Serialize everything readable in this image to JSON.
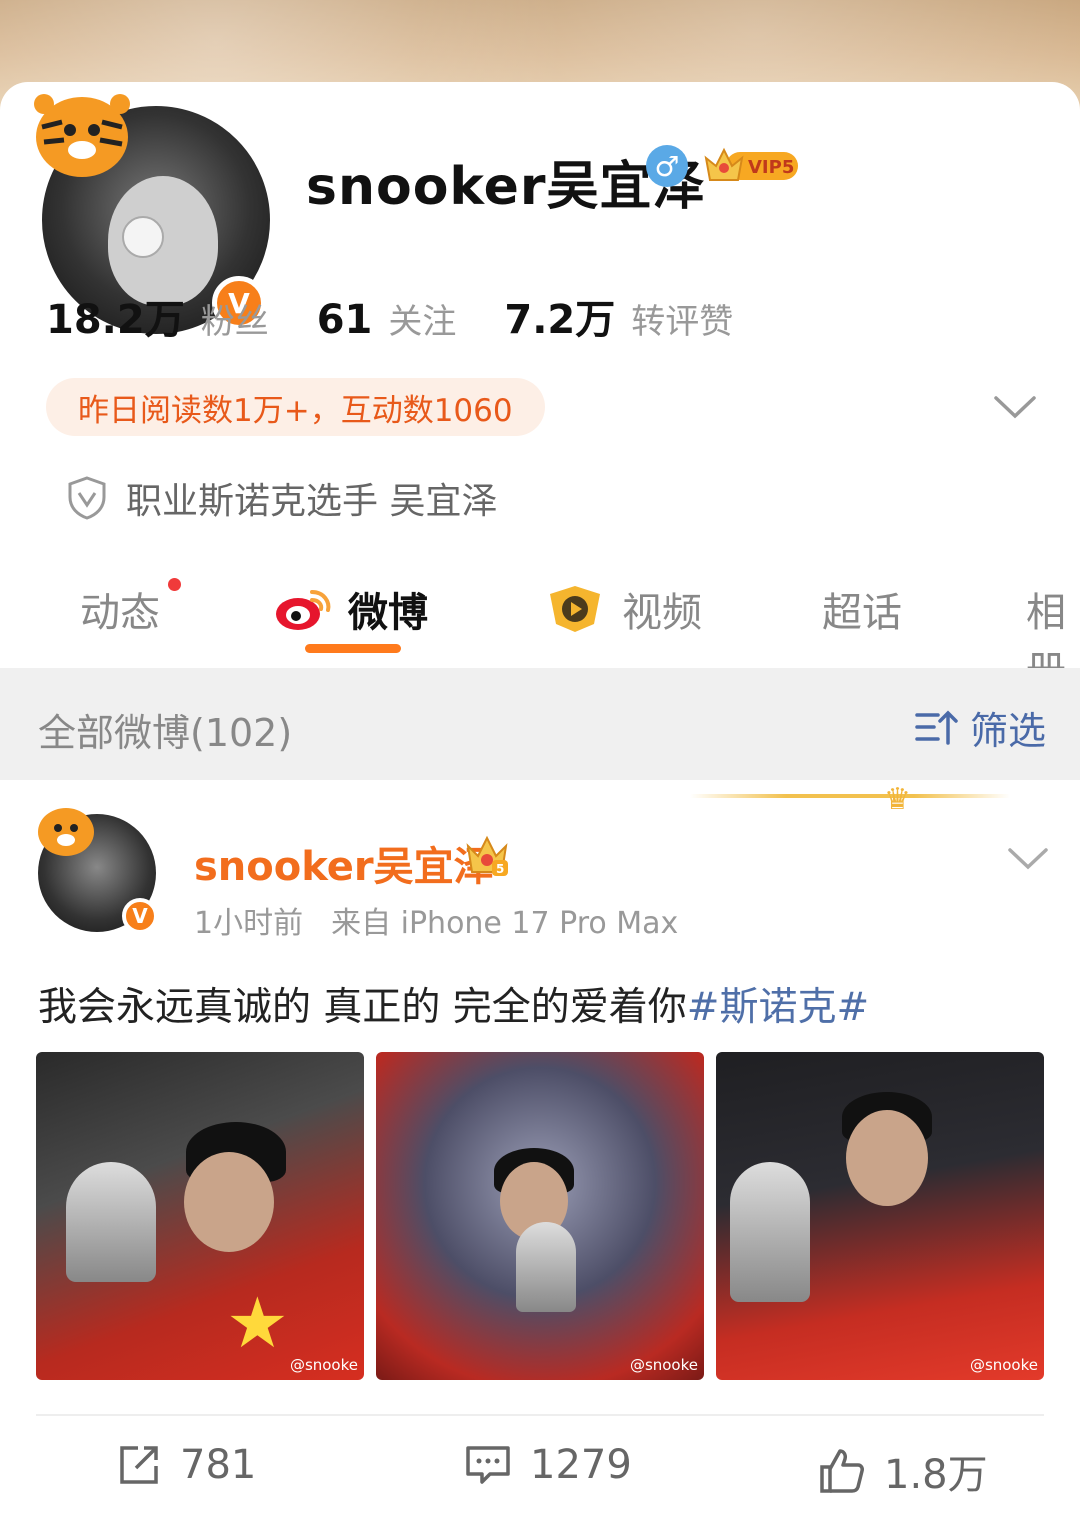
{
  "profile": {
    "username": "snooker吴宜泽",
    "gender_symbol": "♂",
    "vip_label": "VIP5",
    "verified_badge": "V",
    "stats": [
      {
        "value": "18.2万",
        "label": "粉丝"
      },
      {
        "value": "61",
        "label": "关注"
      },
      {
        "value": "7.2万",
        "label": "转评赞"
      }
    ],
    "read_summary": "昨日阅读数1万+，互动数1060",
    "verification": "职业斯诺克选手 吴宜泽"
  },
  "tabs": [
    {
      "label": "动态",
      "has_dot": true
    },
    {
      "label": "微博",
      "active": true
    },
    {
      "label": "视频"
    },
    {
      "label": "超话"
    },
    {
      "label": "相册"
    }
  ],
  "filter": {
    "all_posts": "全部微博(102)",
    "filter_label": "筛选"
  },
  "post": {
    "author": "snooker吴宜泽",
    "crown_level": "5",
    "time": "1小时前",
    "source": "来自 iPhone 17 Pro Max",
    "text": "我会永远真诚的 真正的 完全的爱着你",
    "hashtag": "#斯诺克#",
    "watermark": "@snooke",
    "actions": {
      "repost": "781",
      "comment": "1279",
      "like": "1.8万"
    }
  },
  "colors": {
    "accent": "#ff7a1c",
    "username_orange": "#f26d1d",
    "link_blue": "#4f6fa8"
  }
}
